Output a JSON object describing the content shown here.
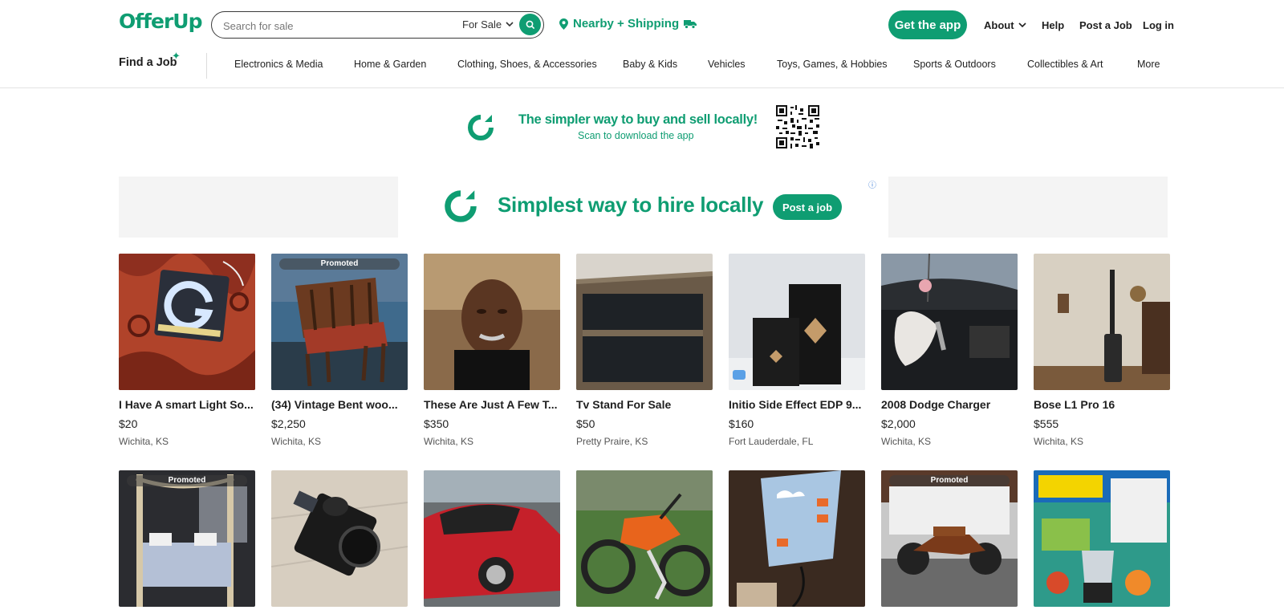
{
  "header": {
    "logo": "OfferUp",
    "search_placeholder": "Search for sale",
    "search_mode": "For Sale",
    "location": "Nearby + Shipping",
    "get_app": "Get the app",
    "about": "About",
    "help": "Help",
    "post_job": "Post a Job",
    "login": "Log in"
  },
  "categories": {
    "find_job": "Find a Job",
    "items": [
      "Electronics & Media",
      "Home & Garden",
      "Clothing, Shoes, & Accessories",
      "Baby & Kids",
      "Vehicles",
      "Toys, Games, & Hobbies",
      "Sports & Outdoors",
      "Collectibles & Art",
      "More"
    ]
  },
  "app_banner": {
    "title": "The simpler way to buy and sell locally!",
    "subtitle": "Scan to download the app"
  },
  "ad": {
    "title": "Simplest way to hire locally",
    "button": "Post a job",
    "info": "ⓘ"
  },
  "colors": {
    "brand": "#0f9d72"
  },
  "listings": [
    {
      "title": "I Have A smart Light So...",
      "price": "$20",
      "location": "Wichita, KS",
      "promoted": false
    },
    {
      "title": "(34) Vintage Bent woo...",
      "price": "$2,250",
      "location": "Wichita, KS",
      "promoted": true,
      "promo_label": "Promoted"
    },
    {
      "title": "These Are Just A Few T...",
      "price": "$350",
      "location": "Wichita, KS",
      "promoted": false
    },
    {
      "title": "Tv Stand For Sale",
      "price": "$50",
      "location": "Pretty Praire, KS",
      "promoted": false
    },
    {
      "title": "Initio Side Effect EDP 9...",
      "price": "$160",
      "location": "Fort Lauderdale, FL",
      "promoted": false
    },
    {
      "title": "2008 Dodge Charger",
      "price": "$2,000",
      "location": "Wichita, KS",
      "promoted": false
    },
    {
      "title": "Bose L1 Pro 16",
      "price": "$555",
      "location": "Wichita, KS",
      "promoted": false
    },
    {
      "promoted": true,
      "promo_label": "Promoted"
    },
    {
      "promoted": false
    },
    {
      "promoted": false
    },
    {
      "promoted": false
    },
    {
      "promoted": false
    },
    {
      "promoted": true,
      "promo_label": "Promoted"
    },
    {
      "promoted": false
    }
  ]
}
